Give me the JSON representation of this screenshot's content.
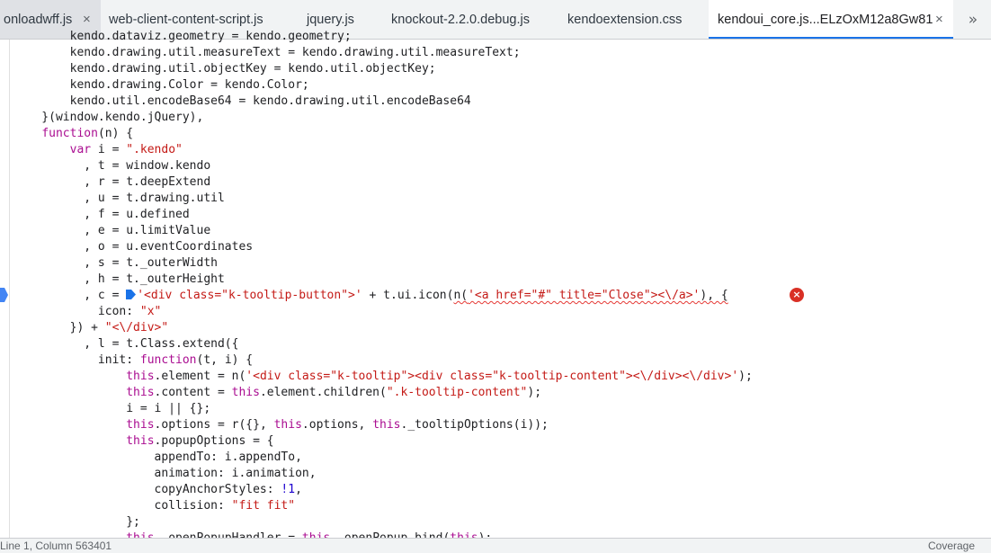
{
  "tabs": [
    {
      "label": "onloadwff.js",
      "close": "×"
    },
    {
      "label": "web-client-content-script.js"
    },
    {
      "label": "jquery.js"
    },
    {
      "label": "knockout-2.2.0.debug.js"
    },
    {
      "label": "kendoextension.css"
    },
    {
      "label": "kendoui_core.js...ELzOxM12a8Gw81",
      "close": "×"
    }
  ],
  "overflow_label": "»",
  "code_lines": [
    "        kendo.dataviz.geometry = kendo.geometry;",
    "        kendo.drawing.util.measureText = kendo.drawing.util.measureText;",
    "        kendo.drawing.util.objectKey = kendo.util.objectKey;",
    "        kendo.drawing.Color = kendo.Color;",
    "        kendo.util.encodeBase64 = kendo.drawing.util.encodeBase64",
    "    }(window.kendo.jQuery),",
    "    function(n) {",
    "        var i = \".kendo\"",
    "          , t = window.kendo",
    "          , r = t.deepExtend",
    "          , u = t.drawing.util",
    "          , f = u.defined",
    "          , e = u.limitValue",
    "          , o = u.eventCoordinates",
    "          , s = t._outerWidth",
    "          , h = t._outerHeight",
    "          , c = '<div class=\"k-tooltip-button\">' + t.ui.icon(n('<a href=\"#\" title=\"Close\"><\\/a>'), {",
    "            icon: \"x\"",
    "        }) + \"<\\/div>\"",
    "          , l = t.Class.extend({",
    "            init: function(t, i) {",
    "                this.element = n('<div class=\"k-tooltip\"><div class=\"k-tooltip-content\"><\\/div><\\/div>');",
    "                this.content = this.element.children(\".k-tooltip-content\");",
    "                i = i || {};",
    "                this.options = r({}, this.options, this._tooltipOptions(i));",
    "                this.popupOptions = {",
    "                    appendTo: i.appendTo,",
    "                    animation: i.animation,",
    "                    copyAnchorStyles: !1,",
    "                    collision: \"fit fit\"",
    "                };",
    "                this._openPopupHandler = this._openPopup.bind(this);"
  ],
  "error_icon": "×",
  "status": {
    "position": "Line 1, Column 563401",
    "coverage": "Coverage"
  },
  "colors": {
    "keyword": "#aa0d91",
    "string": "#c41a16",
    "number": "#1c00cf",
    "accent": "#1a73e8",
    "error": "#d93025"
  }
}
